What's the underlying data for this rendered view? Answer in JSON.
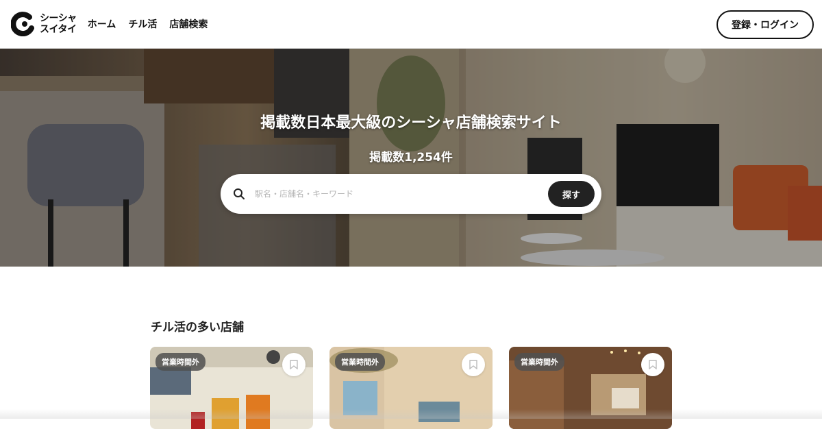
{
  "header": {
    "logo": {
      "line1": "シーシャ",
      "line2": "スイタイ"
    },
    "nav": [
      {
        "label": "ホーム"
      },
      {
        "label": "チル活"
      },
      {
        "label": "店舗検索"
      }
    ],
    "login_label": "登録・ログイン"
  },
  "hero": {
    "title": "掲載数日本最大級のシーシャ店舗検索サイト",
    "count": "掲載数1,254件",
    "search": {
      "placeholder": "駅名・店舗名・キーワード",
      "button_label": "探す"
    }
  },
  "section": {
    "title": "チル活の多い店舗",
    "cards": [
      {
        "badge": "営業時間外"
      },
      {
        "badge": "営業時間外"
      },
      {
        "badge": "営業時間外"
      }
    ]
  },
  "icons": {
    "search": "search-icon",
    "bookmark": "bookmark-icon"
  },
  "colors": {
    "primary": "#222222",
    "badge_bg": "#505050"
  }
}
